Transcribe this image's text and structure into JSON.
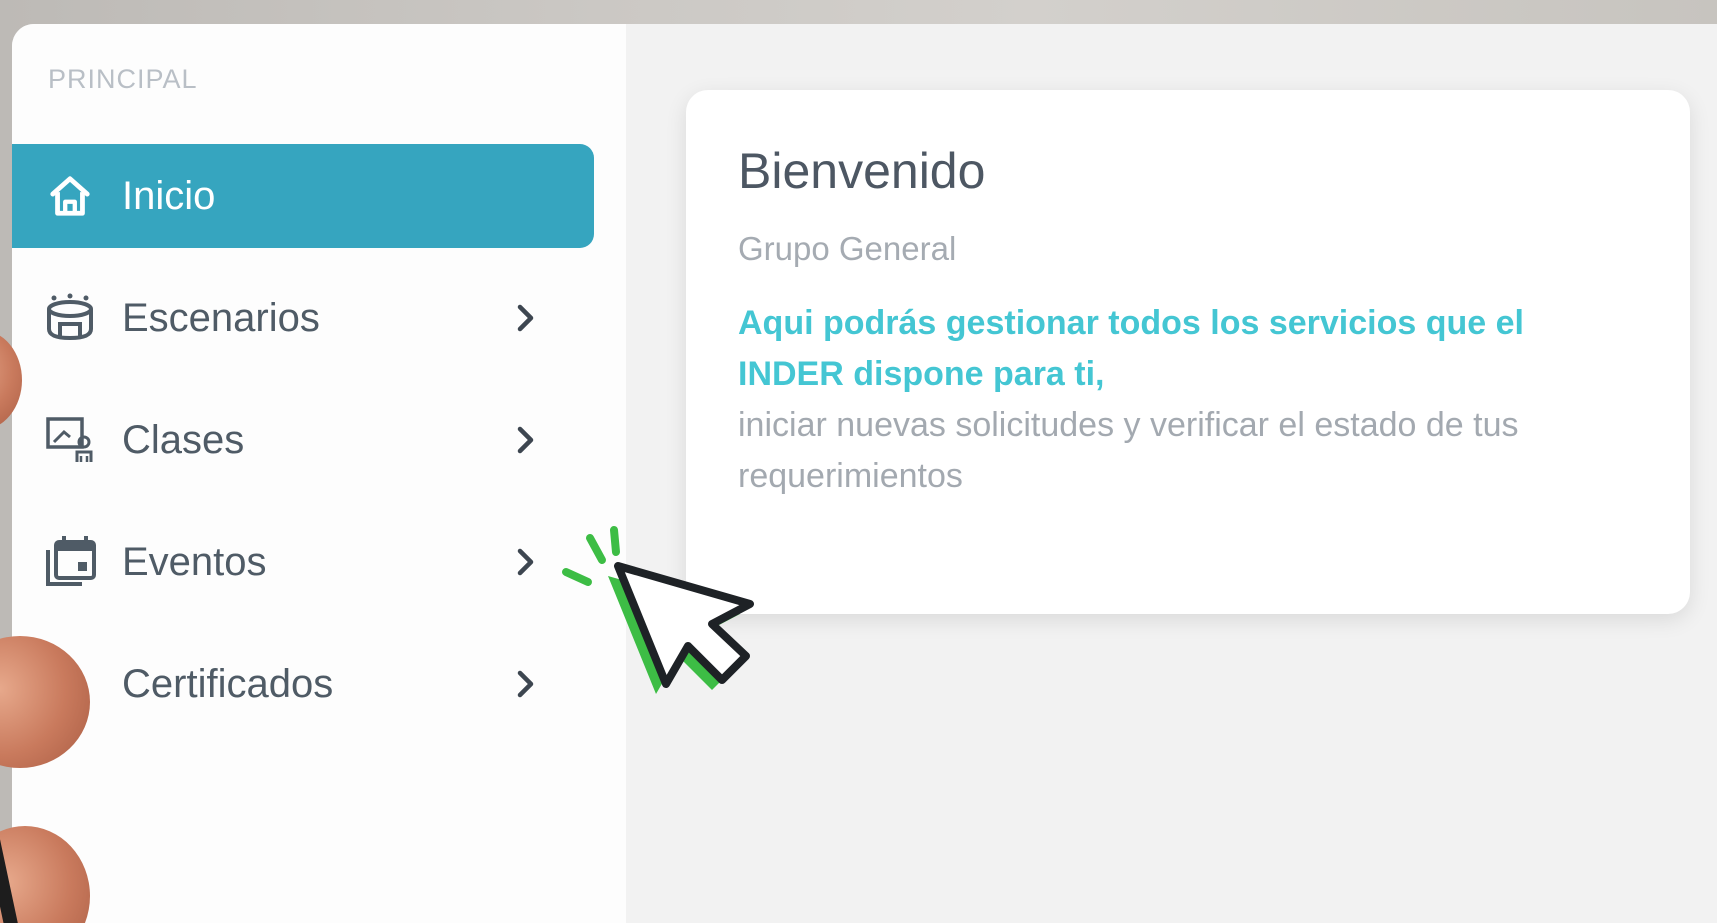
{
  "sidebar": {
    "section_label": "PRINCIPAL",
    "items": [
      {
        "label": "Inicio",
        "icon": "home-icon",
        "active": true
      },
      {
        "label": "Escenarios",
        "icon": "stadium-icon",
        "has_submenu": true
      },
      {
        "label": "Clases",
        "icon": "class-board-icon",
        "has_submenu": true
      },
      {
        "label": "Eventos",
        "icon": "calendar-events-icon",
        "has_submenu": true
      },
      {
        "label": "Certificados",
        "icon": "",
        "has_submenu": true
      }
    ]
  },
  "welcome_card": {
    "title": "Bienvenido",
    "subtitle": "Grupo General",
    "highlight": "Aqui podrás gestionar todos los servicios que el INDER dispone para ti,",
    "body": "iniciar nuevas solicitudes y verificar el estado de tus requerimientos"
  },
  "colors": {
    "accent": "#36a5bf",
    "highlight_text": "#44c6d3",
    "cursor_green": "#3dbd45"
  }
}
